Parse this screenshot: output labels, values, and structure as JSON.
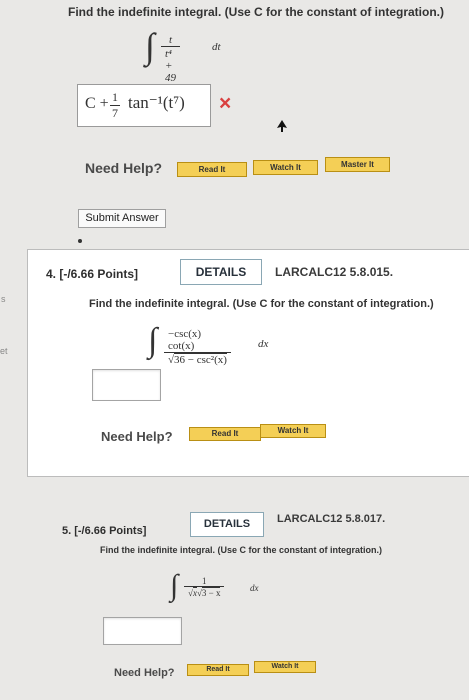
{
  "side_marks": [
    "s",
    "et"
  ],
  "q3": {
    "prompt": "Find the indefinite integral. (Use C for the constant of integration.)",
    "integral": {
      "numerator": "t",
      "denominator": "t⁴ + 49",
      "differential": "dt"
    },
    "answer": {
      "prefix": "C +",
      "frac_num": "1",
      "frac_den": "7",
      "func": "tan⁻¹(t⁷)"
    },
    "result_mark": "×",
    "need_help": "Need Help?",
    "help_buttons": [
      "Read It",
      "Watch It",
      "Master It"
    ],
    "submit": "Submit Answer"
  },
  "q4": {
    "label": "4. [-/6.66 Points]",
    "details": "DETAILS",
    "ref": "LARCALC12 5.8.015.",
    "prompt": "Find the indefinite integral. (Use C for the constant of integration.)",
    "integral": {
      "numerator": "−csc(x) cot(x)",
      "radicand": "36 − csc²(x)",
      "differential": "dx"
    },
    "need_help": "Need Help?",
    "help_buttons": [
      "Read It",
      "Watch It"
    ]
  },
  "q5": {
    "label": "5. [-/6.66 Points]",
    "details": "DETAILS",
    "ref": "LARCALC12 5.8.017.",
    "prompt": "Find the indefinite integral. (Use C for the constant of integration.)",
    "integral": {
      "numerator": "1",
      "den_left": "x",
      "den_right": "3 − x",
      "differential": "dx"
    },
    "need_help": "Need Help?",
    "help_buttons": [
      "Read It",
      "Watch It"
    ]
  }
}
